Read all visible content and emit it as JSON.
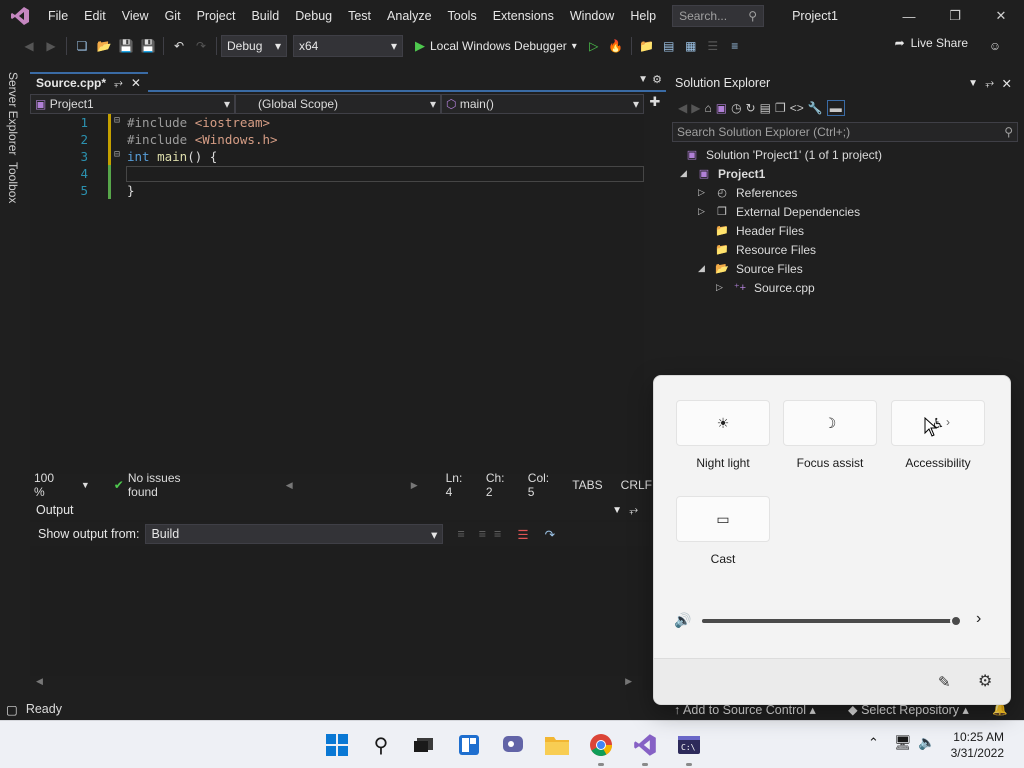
{
  "window": {
    "title": "Project1",
    "menu": [
      "File",
      "Edit",
      "View",
      "Git",
      "Project",
      "Build",
      "Debug",
      "Test",
      "Analyze",
      "Tools",
      "Extensions",
      "Window",
      "Help"
    ],
    "search_placeholder": "Search..."
  },
  "toolbar": {
    "configuration": "Debug",
    "platform": "x64",
    "run_label": "Local Windows Debugger",
    "live_share": "Live Share"
  },
  "side_tabs": [
    "Server Explorer",
    "Toolbox"
  ],
  "editor": {
    "tab_label": "Source.cpp*",
    "nav_project": "Project1",
    "nav_scope": "(Global Scope)",
    "nav_member": "main()",
    "lines": [
      {
        "num": "1",
        "parts": [
          {
            "t": "#include ",
            "c": "pp"
          },
          {
            "t": "<iostream>",
            "c": "str"
          }
        ]
      },
      {
        "num": "2",
        "parts": [
          {
            "t": "#include ",
            "c": "pp"
          },
          {
            "t": "<Windows.h>",
            "c": "str"
          }
        ]
      },
      {
        "num": "3",
        "parts": [
          {
            "t": "int",
            "c": "kw"
          },
          {
            "t": " ",
            "c": ""
          },
          {
            "t": "main",
            "c": "fn"
          },
          {
            "t": "() {",
            "c": ""
          }
        ]
      },
      {
        "num": "4",
        "parts": []
      },
      {
        "num": "5",
        "parts": [
          {
            "t": "}",
            "c": ""
          }
        ]
      }
    ],
    "zoom": "100 %",
    "issues": "No issues found",
    "line_pos": "Ln: 4",
    "char_pos": "Ch: 2",
    "col_pos": "Col: 5",
    "indent": "TABS",
    "line_ending": "CRLF"
  },
  "output": {
    "title": "Output",
    "source_label": "Show output from:",
    "source_value": "Build"
  },
  "solution_explorer": {
    "title": "Solution Explorer",
    "search_placeholder": "Search Solution Explorer (Ctrl+;)",
    "solution": "Solution 'Project1' (1 of 1 project)",
    "project": "Project1",
    "items": [
      "References",
      "External Dependencies",
      "Header Files",
      "Resource Files",
      "Source Files"
    ],
    "source_file": "Source.cpp"
  },
  "statusbar": {
    "ready": "Ready",
    "add_source": "Add to Source Control",
    "select_repo": "Select Repository"
  },
  "quick_settings": {
    "tiles": [
      {
        "label": "Night light",
        "icon": "brightness-icon"
      },
      {
        "label": "Focus assist",
        "icon": "moon-icon"
      },
      {
        "label": "Accessibility",
        "icon": "accessibility-icon"
      },
      {
        "label": "Cast",
        "icon": "cast-icon"
      }
    ],
    "volume_percent": 100
  },
  "taskbar": {
    "time": "10:25 AM",
    "date": "3/31/2022"
  },
  "colors": {
    "accent": "#3a6ba5",
    "run_green": "#4ec94e",
    "vs_purple": "#b180d7"
  }
}
